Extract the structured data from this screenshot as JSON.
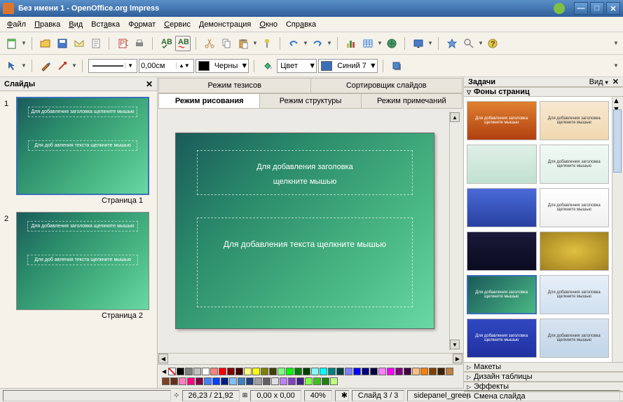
{
  "window": {
    "title": "Без имени 1 - OpenOffice.org Impress"
  },
  "menu": {
    "file": "Файл",
    "edit": "Правка",
    "view": "Вид",
    "insert": "Вставка",
    "format": "Формат",
    "tools": "Сервис",
    "slideshow": "Демонстрация",
    "window": "Окно",
    "help": "Справка"
  },
  "toolbar2": {
    "line_width": "0,00см",
    "color1_label": "Черны",
    "color1_hex": "#000000",
    "color2_label": "Цвет",
    "color3_label": "Синий 7",
    "color3_hex": "#3a6fb8"
  },
  "view_tabs_top": {
    "thesis": "Режим тезисов",
    "sorter": "Сортировщик слайдов"
  },
  "view_tabs": {
    "drawing": "Режим рисования",
    "outline": "Режим структуры",
    "notes": "Режим примечаний"
  },
  "slides_panel": {
    "title": "Слайды",
    "page1": "Страница 1",
    "page2": "Страница 2",
    "thumb_title": "Для добавления заголовка щелкните мышью",
    "thumb_text": "Для доб авления текста щелкните мышью"
  },
  "slide": {
    "title_line1": "Для добавления заголовка",
    "title_line2": "щелкните мышью",
    "text": "Для добавления текста щелкните мышью"
  },
  "tasks_panel": {
    "title": "Задачи",
    "view_label": "Вид",
    "sections": {
      "backgrounds": "Фоны страниц",
      "layouts": "Макеты",
      "table_design": "Дизайн таблицы",
      "effects": "Эффекты",
      "transition": "Смена слайда"
    }
  },
  "templates": [
    {
      "bg": "linear-gradient(#e08030,#b04010)",
      "txt": "Для добавления заголовка щелкните мышью"
    },
    {
      "bg": "linear-gradient(#f8e8d0,#f0d8b0)",
      "txt": "Для добавления заголовка щелкните мышью"
    },
    {
      "bg": "linear-gradient(#e0f0e8,#c0e0d0)",
      "txt": ""
    },
    {
      "bg": "linear-gradient(#f0f8f4,#e0f0e8)",
      "txt": "Для добавления заголовка щелкните мышью"
    },
    {
      "bg": "linear-gradient(#4a6ad8,#2840a0)",
      "txt": ""
    },
    {
      "bg": "linear-gradient(#ffffff,#f0f0f0)",
      "txt": "Для добавления заголовка щелкните мышью"
    },
    {
      "bg": "linear-gradient(#1a1a3a,#0a0a20)",
      "txt": ""
    },
    {
      "bg": "radial-gradient(#e0c040,#a08020)",
      "txt": ""
    },
    {
      "bg": "linear-gradient(135deg,#1a5a5a,#4ab884)",
      "txt": "Для добавления заголовка щелкните мышью"
    },
    {
      "bg": "linear-gradient(#e8f0f8,#d0e0f0)",
      "txt": "Для добавления заголовка щелкните мышью"
    },
    {
      "bg": "linear-gradient(#3048c0,#2030a0)",
      "txt": "Для добавления заголовка щелкните мышью"
    },
    {
      "bg": "linear-gradient(#d8e4f0,#c0d4e8)",
      "txt": "Для добавления заголовка щелкните мышью"
    }
  ],
  "palette": [
    "#000000",
    "#808080",
    "#c0c0c0",
    "#ffffff",
    "#ff8080",
    "#ff0000",
    "#800000",
    "#400000",
    "#ffff80",
    "#ffff00",
    "#808000",
    "#404000",
    "#80ff80",
    "#00ff00",
    "#008000",
    "#004000",
    "#80ffff",
    "#00ffff",
    "#008080",
    "#004040",
    "#8080ff",
    "#0000ff",
    "#000080",
    "#000040",
    "#ff80ff",
    "#ff00ff",
    "#800080",
    "#400040",
    "#ffc080",
    "#ff8000",
    "#804000",
    "#402000",
    "#c08040",
    "#804020",
    "#603018",
    "#ff80c0",
    "#ff0080",
    "#800040",
    "#4080ff",
    "#0040ff",
    "#002080",
    "#80c0ff",
    "#4080c0",
    "#204080",
    "#a0a0a0",
    "#606060",
    "#e0e0e0",
    "#c080ff",
    "#8040c0",
    "#402080",
    "#80ff40",
    "#40c020",
    "#208010",
    "#c0ff80"
  ],
  "status": {
    "pos": "26,23 / 21,92",
    "size": "0,00 x 0,00",
    "zoom": "40%",
    "slide": "Слайд  3 / 3",
    "template": "sidepanel_green"
  }
}
